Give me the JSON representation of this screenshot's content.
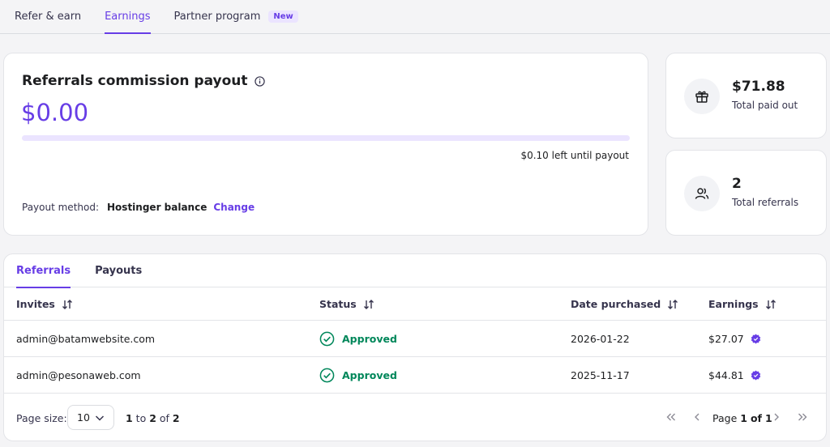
{
  "top_tabs": [
    {
      "label": "Refer & earn"
    },
    {
      "label": "Earnings"
    },
    {
      "label": "Partner program",
      "badge": "New"
    }
  ],
  "payout": {
    "title": "Referrals commission payout",
    "amount": "$0.00",
    "progress_fraction": 0.0,
    "left_until_payout": "$0.10 left until payout",
    "method_label": "Payout method:",
    "method_value": "Hostinger balance",
    "change_label": "Change"
  },
  "stats": [
    {
      "value": "$71.88",
      "label": "Total paid out",
      "icon": "gift-icon"
    },
    {
      "value": "2",
      "label": "Total referrals",
      "icon": "users-icon"
    }
  ],
  "table": {
    "tabs": [
      {
        "label": "Referrals"
      },
      {
        "label": "Payouts"
      }
    ],
    "columns": [
      "Invites",
      "Status",
      "Date purchased",
      "Earnings"
    ],
    "rows": [
      {
        "invite": "admin@batamwebsite.com",
        "status": "Approved",
        "date": "2026-01-22",
        "earnings": "$27.07"
      },
      {
        "invite": "admin@pesonaweb.com",
        "status": "Approved",
        "date": "2025-11-17",
        "earnings": "$44.81"
      }
    ],
    "pager": {
      "page_size_label": "Page size:",
      "page_size": "10",
      "range_from": "1",
      "range_to": "2",
      "range_total": "2",
      "page_word": "Page",
      "page_current": "1",
      "page_of": "of",
      "page_total": "1"
    }
  },
  "colors": {
    "accent": "#673de6",
    "success": "#00875a"
  }
}
